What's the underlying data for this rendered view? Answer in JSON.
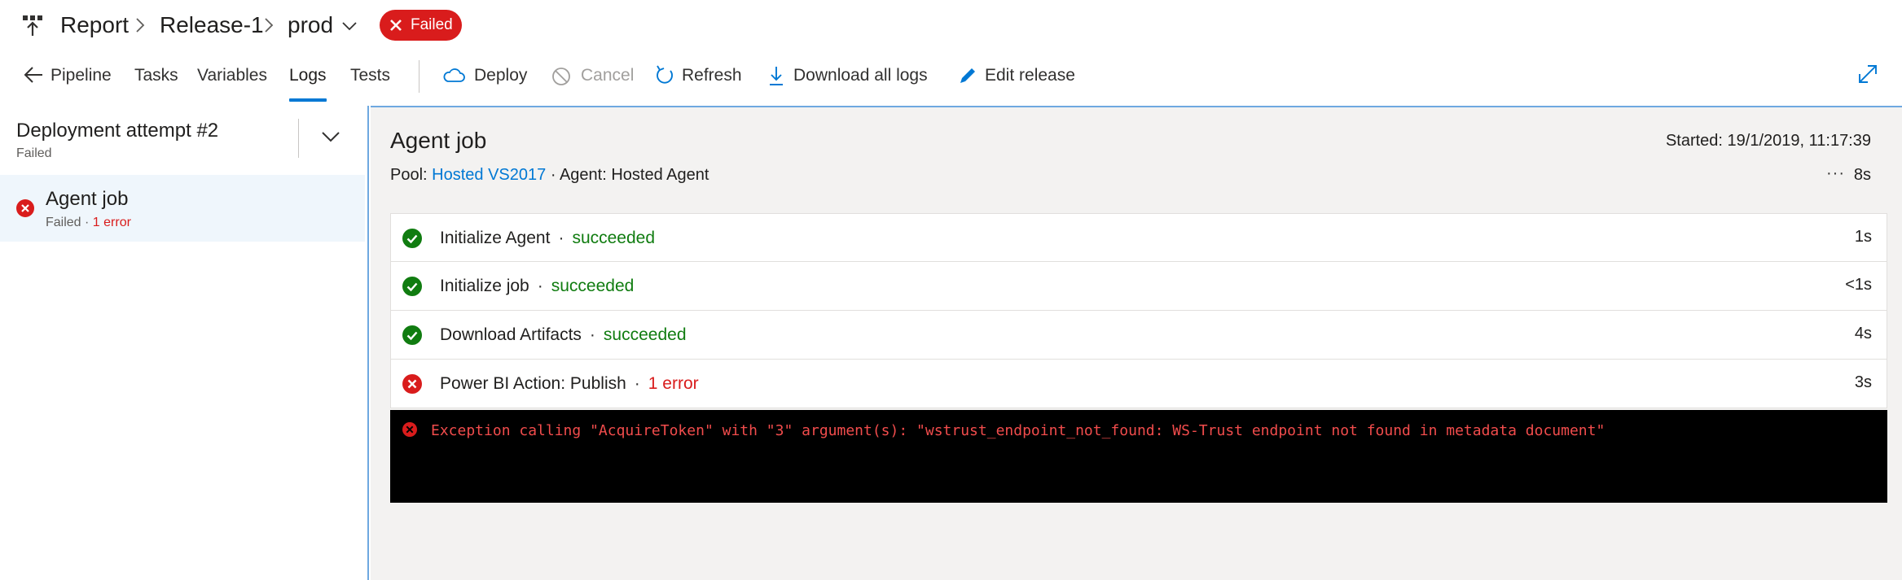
{
  "header": {
    "icon": "release-icon",
    "breadcrumb": [
      "Report",
      "Release-1",
      "prod"
    ],
    "status": "Failed"
  },
  "tabs": [
    {
      "label": "Pipeline",
      "icon": "back-arrow-icon"
    },
    {
      "label": "Tasks"
    },
    {
      "label": "Variables"
    },
    {
      "label": "Logs",
      "active": true
    },
    {
      "label": "Tests"
    }
  ],
  "actions": [
    {
      "label": "Deploy",
      "icon": "cloud-icon"
    },
    {
      "label": "Cancel",
      "icon": "cancel-icon",
      "disabled": true
    },
    {
      "label": "Refresh",
      "icon": "refresh-icon"
    },
    {
      "label": "Download all logs",
      "icon": "download-icon"
    },
    {
      "label": "Edit release",
      "icon": "pencil-icon"
    }
  ],
  "left": {
    "attempt_title": "Deployment attempt #2",
    "attempt_status": "Failed",
    "job": {
      "name": "Agent job",
      "status": "Failed",
      "sep": " · ",
      "errors": "1 error"
    }
  },
  "right": {
    "title": "Agent job",
    "pool_label": "Pool:",
    "pool_link": "Hosted VS2017",
    "agent": "· Agent: Hosted Agent",
    "started": "Started: 19/1/2019, 11:17:39",
    "more": "···",
    "duration": "8s",
    "steps": [
      {
        "name": "Initialize Agent",
        "status": "succeeded",
        "state": "ok",
        "duration": "1s"
      },
      {
        "name": "Initialize job",
        "status": "succeeded",
        "state": "ok",
        "duration": "<1s"
      },
      {
        "name": "Download Artifacts",
        "status": "succeeded",
        "state": "ok",
        "duration": "4s"
      },
      {
        "name": "Power BI Action: Publish",
        "status": "1 error",
        "state": "err",
        "duration": "3s"
      }
    ],
    "log_error": "Exception calling \"AcquireToken\" with \"3\" argument(s): \"wstrust_endpoint_not_found: WS-Trust endpoint not found in metadata document\""
  },
  "colors": {
    "accent": "#0078d4",
    "error": "#d91c1c",
    "success": "#107c10"
  }
}
